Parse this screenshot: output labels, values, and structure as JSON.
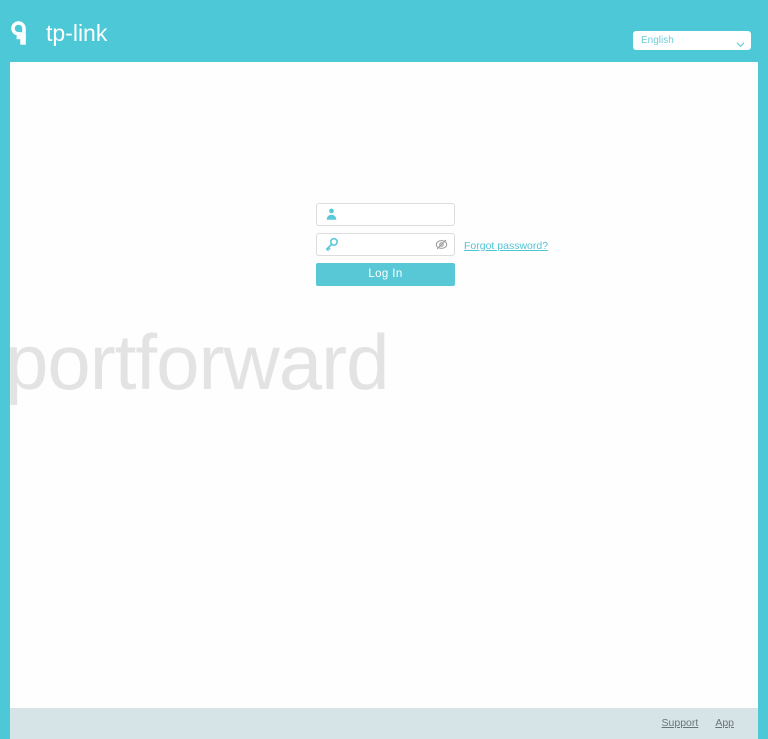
{
  "brand": {
    "name": "tp-link",
    "logo_icon": "tplink-logo-icon",
    "header_color": "#4cc8d6"
  },
  "header": {
    "language": {
      "selected": "English",
      "chevron_icon": "chevron-down-icon"
    }
  },
  "watermark": {
    "text": "portforward",
    "color": "#e3e3e3"
  },
  "login": {
    "username": {
      "icon": "user-icon",
      "value": "",
      "placeholder": ""
    },
    "password": {
      "icon": "key-icon",
      "value": "",
      "placeholder": "",
      "toggle_icon": "eye-slash-icon"
    },
    "forgot_password_label": "Forgot password?",
    "submit_label": "Log In",
    "accent_color": "#58c8d7"
  },
  "footer": {
    "links": [
      {
        "label": "Support"
      },
      {
        "label": "App"
      }
    ],
    "background_color": "#d6e4e7"
  }
}
